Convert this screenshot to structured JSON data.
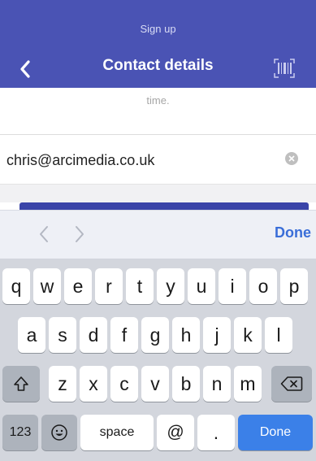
{
  "header": {
    "subtitle": "Sign up",
    "title": "Contact details"
  },
  "form": {
    "hint_text": "time.",
    "email_value": "chris@arcimedia.co.uk"
  },
  "accessory": {
    "done_label": "Done"
  },
  "keyboard": {
    "row1": [
      "q",
      "w",
      "e",
      "r",
      "t",
      "y",
      "u",
      "i",
      "o",
      "p"
    ],
    "row2": [
      "a",
      "s",
      "d",
      "f",
      "g",
      "h",
      "j",
      "k",
      "l"
    ],
    "row3": [
      "z",
      "x",
      "c",
      "v",
      "b",
      "n",
      "m"
    ],
    "numbers_label": "123",
    "space_label": "space",
    "at_label": "@",
    "dot_label": ".",
    "done_label": "Done"
  },
  "colors": {
    "header": "#4a53b4",
    "accent_blue": "#3b80e8",
    "keyboard_bg": "#d3d6dd"
  },
  "icons": {
    "back": "chevron-left-icon",
    "scan": "barcode-scan-icon",
    "clear": "clear-x-icon",
    "shift": "shift-arrow-icon",
    "delete": "backspace-icon",
    "emoji": "emoji-face-icon"
  }
}
